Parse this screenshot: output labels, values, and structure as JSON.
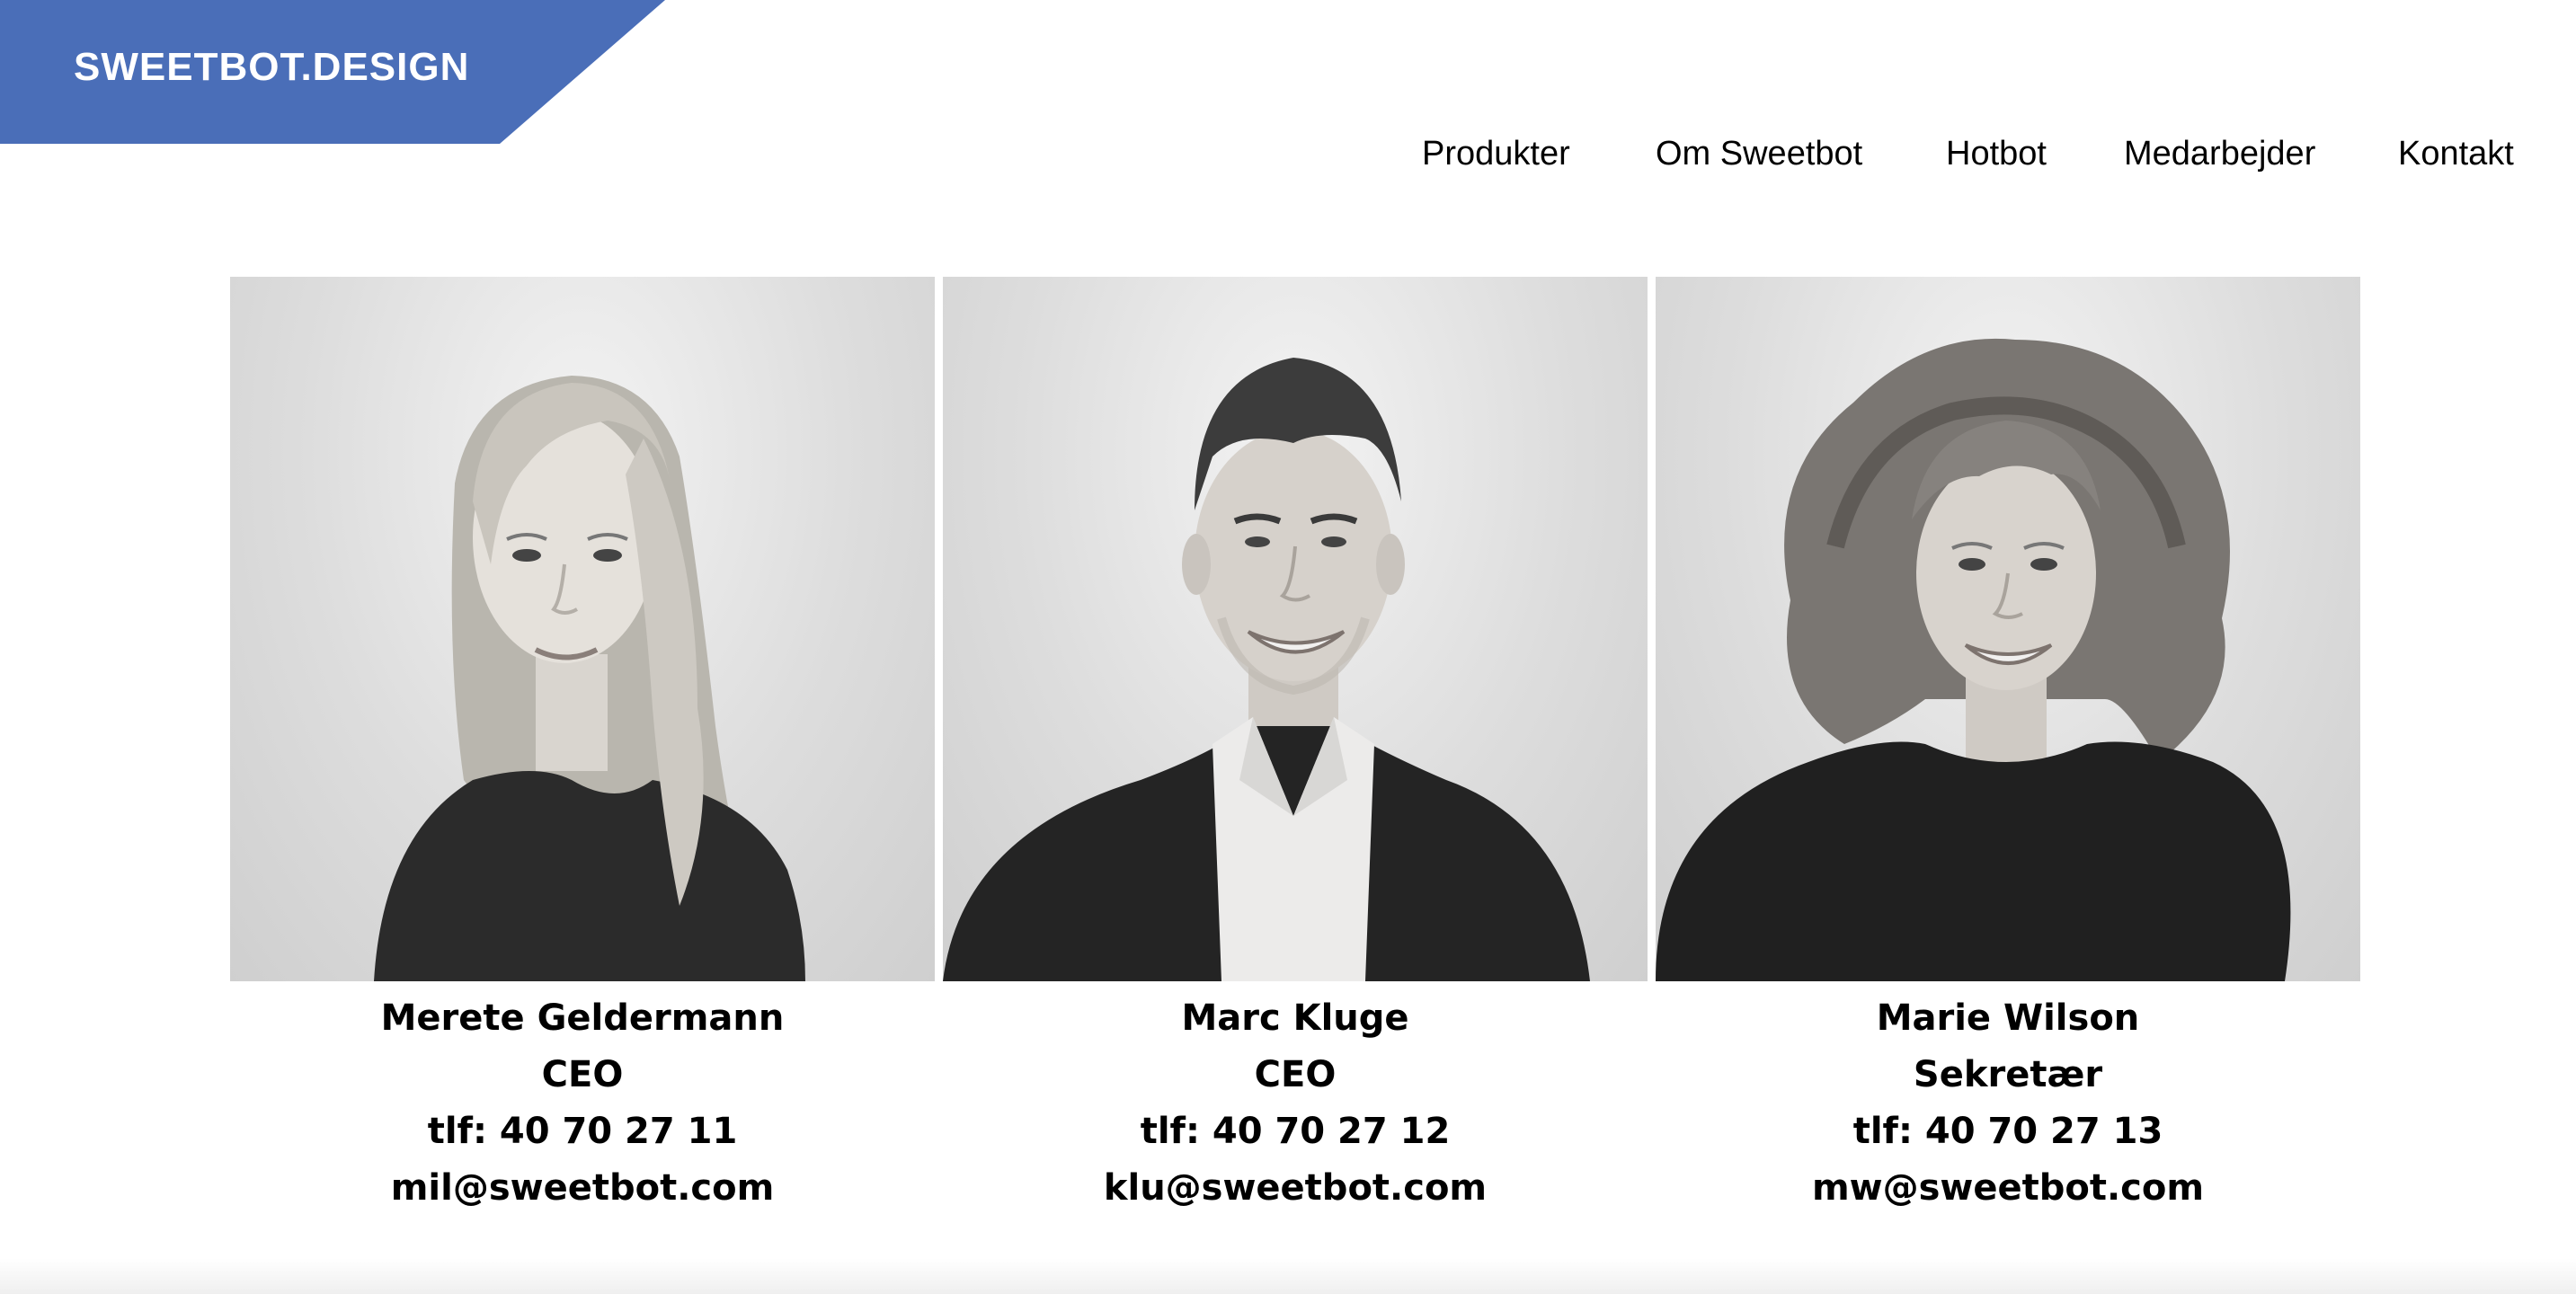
{
  "logo": {
    "text": "SWEETBOT.DESIGN",
    "color": "#4a6eb8"
  },
  "nav": {
    "items": [
      {
        "label": "Produkter"
      },
      {
        "label": "Om Sweetbot"
      },
      {
        "label": "Hotbot"
      },
      {
        "label": "Medarbejder"
      },
      {
        "label": "Kontakt"
      }
    ]
  },
  "team": {
    "members": [
      {
        "name": "Merete Geldermann",
        "role": "CEO",
        "phone": "tlf: 40 70 27 11",
        "email": "mil@sweetbot.com",
        "photo_icon": "portrait-woman-long-hair"
      },
      {
        "name": "Marc Kluge",
        "role": "CEO",
        "phone": "tlf: 40 70 27 12",
        "email": "klu@sweetbot.com",
        "photo_icon": "portrait-man-suit"
      },
      {
        "name": "Marie Wilson",
        "role": "Sekretær",
        "phone": "tlf: 40 70 27 13",
        "email": "mw@sweetbot.com",
        "photo_icon": "portrait-woman-curly-hair"
      }
    ]
  }
}
